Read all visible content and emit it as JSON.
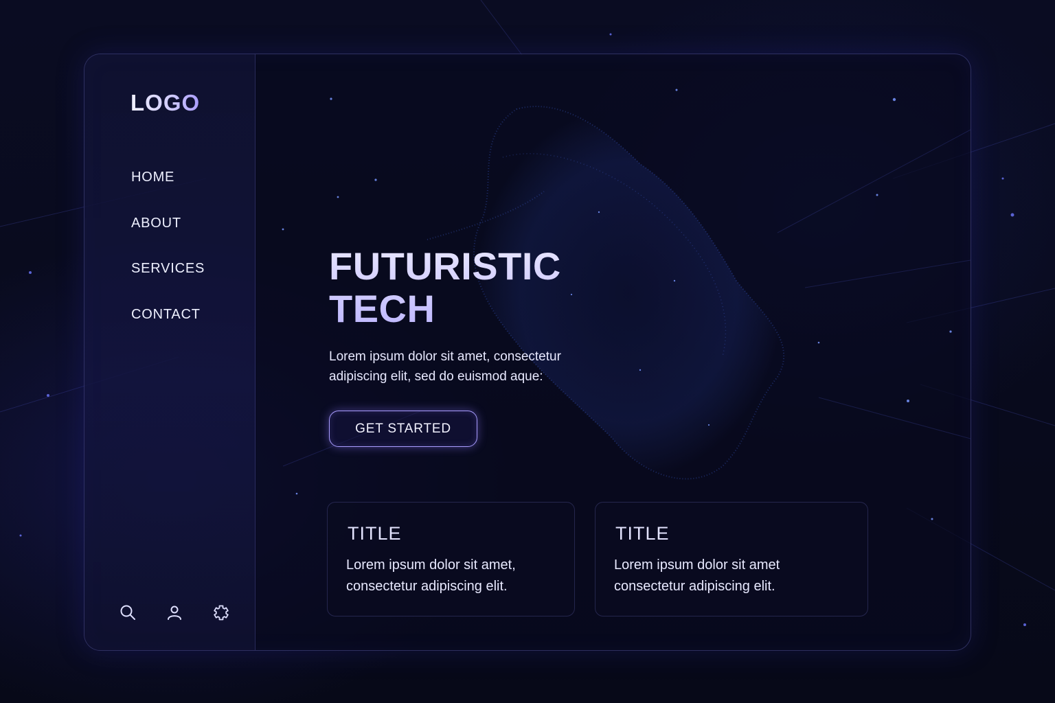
{
  "brand": {
    "logo": "LOGO"
  },
  "sidebar": {
    "nav": [
      {
        "label": "HOME"
      },
      {
        "label": "ABOUT"
      },
      {
        "label": "SERVICES"
      },
      {
        "label": "CONTACT"
      }
    ],
    "icons": [
      "search-icon",
      "user-icon",
      "settings-icon"
    ]
  },
  "hero": {
    "title_line1": "FUTURISTIC",
    "title_line2": "TECH",
    "text": "Lorem ipsum dolor sit amet, consectetur adipiscing elit, sed do euismod aque:",
    "cta_label": "GET STARTED"
  },
  "cards": [
    {
      "title": "TITLE",
      "body": "Lorem ipsum dolor sit amet, consectetur adipiscing elit."
    },
    {
      "title": "TITLE",
      "body": "Lorem ipsum dolor sit amet consectetur adipiscing elit."
    }
  ],
  "colors": {
    "background": "#080a1c",
    "accent": "#a99dff",
    "text": "#e8e9ff"
  }
}
